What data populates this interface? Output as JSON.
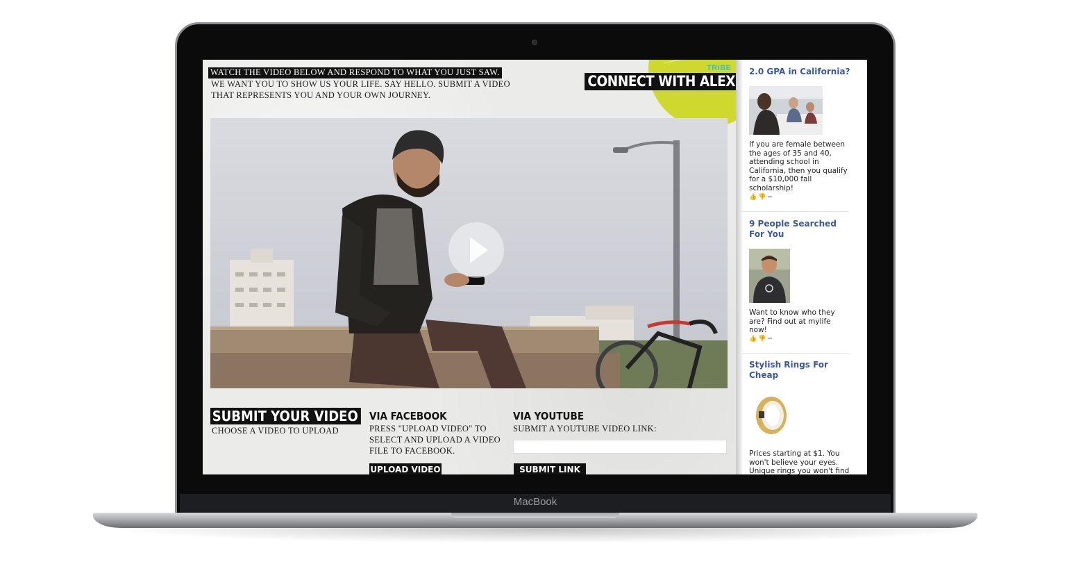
{
  "device": {
    "label": "MacBook"
  },
  "page": {
    "intro": {
      "highlight": "WATCH THE VIDEO BELOW AND RESPOND TO WHAT YOU JUST SAW.",
      "line2": "WE WANT YOU TO SHOW US YOUR LIFE. SAY HELLO. SUBMIT A VIDEO",
      "line3": "THAT REPRESENTS YOU AND YOUR OWN JOURNEY."
    },
    "brand": {
      "tribe": "TRIBE",
      "title": "CONNECT WITH ALEX"
    },
    "submit": {
      "title": "SUBMIT YOUR VIDEO",
      "subtitle": "CHOOSE A VIDEO TO UPLOAD",
      "facebook": {
        "heading": "VIA FACEBOOK",
        "line1": "PRESS \"UPLOAD VIDEO\" TO",
        "line2": "SELECT AND UPLOAD A VIDEO",
        "line3": "FILE TO FACEBOOK.",
        "button": "UPLOAD VIDEO"
      },
      "youtube": {
        "heading": "VIA YOUTUBE",
        "instruction": "SUBMIT A YOUTUBE VIDEO LINK:",
        "input_value": "",
        "button": "SUBMIT LINK"
      }
    }
  },
  "ads": [
    {
      "title": "2.0 GPA in California?",
      "text": "If you are female between the ages of 35 and 40, attending school in California, then you qualify for a $10,000 fall scholarship!"
    },
    {
      "title": "9 People Searched For You",
      "text": "Want to know who they are? Find out at mylife now!"
    },
    {
      "title": "Stylish Rings For Cheap",
      "text": "Prices starting at $1. You won't believe your eyes. Unique rings you won't find"
    }
  ],
  "icons": {
    "play": "play-icon",
    "ad_actions": [
      "thumbs-up-icon",
      "thumbs-down-icon",
      "share-icon"
    ]
  },
  "colors": {
    "accent_green": "#cfd82f",
    "accent_teal": "#3dbfc3",
    "ad_link": "#3b5998",
    "panel_bg": "#ebebea"
  }
}
